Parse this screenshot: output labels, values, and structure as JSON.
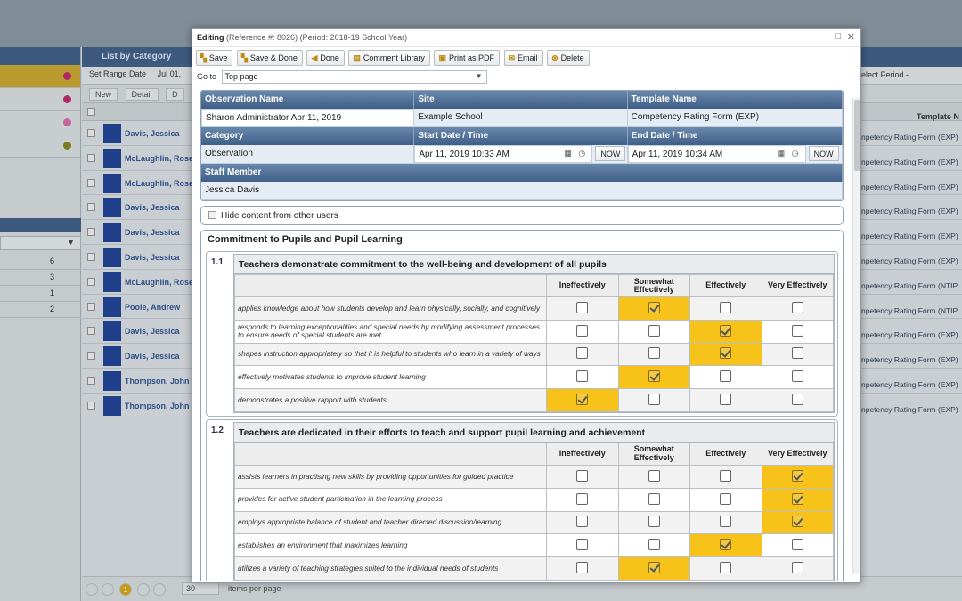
{
  "background": {
    "list_header": "List by Category",
    "toolbar": {
      "set_range": "Set Range Date",
      "date_fragment": "Jul 01,"
    },
    "actions": {
      "new": "New",
      "detail": "Detail",
      "more": "D"
    },
    "period_select": "elect Period -",
    "grid_header_right": "Template N",
    "left_dots": [
      "#b0286a",
      "#b0286a",
      "#c4669c",
      "#7a7a20"
    ],
    "counts": [
      "6",
      "3",
      "1",
      "2"
    ],
    "rows": [
      {
        "name": "Davis, Jessica",
        "template": "npetency Rating Form (EXP)"
      },
      {
        "name": "McLaughlin, Rose",
        "template": "npetency Rating Form (EXP)"
      },
      {
        "name": "McLaughlin, Rose",
        "template": "npetency Rating Form (EXP)"
      },
      {
        "name": "Davis, Jessica",
        "template": "npetency Rating Form (EXP)"
      },
      {
        "name": "Davis, Jessica",
        "template": "npetency Rating Form (EXP)"
      },
      {
        "name": "Davis, Jessica",
        "template": "npetency Rating Form (EXP)"
      },
      {
        "name": "McLaughlin, Rose",
        "template": "npetency Rating Form (NTIP"
      },
      {
        "name": "Poole, Andrew",
        "template": "npetency Rating Form (NTIP"
      },
      {
        "name": "Davis, Jessica",
        "template": "npetency Rating Form (EXP)"
      },
      {
        "name": "Davis, Jessica",
        "template": "npetency Rating Form (EXP)"
      },
      {
        "name": "Thompson, John",
        "template": "npetency Rating Form (EXP)"
      },
      {
        "name": "Thompson, John",
        "template": "npetency Rating Form (EXP)"
      }
    ],
    "pager": {
      "current_page": "1",
      "page_size": "30",
      "items_per_page": "items per page"
    }
  },
  "dialog": {
    "title_bold": "Editing",
    "title_rest": "(Reference #: 8026) (Period: 2018-19 School Year)",
    "toolbar": {
      "save": "Save",
      "save_done": "Save & Done",
      "done": "Done",
      "comment_library": "Comment Library",
      "print_pdf": "Print as PDF",
      "email": "Email",
      "delete": "Delete"
    },
    "goto_label": "Go to",
    "goto_value": "Top page",
    "info": {
      "observation_name_label": "Observation Name",
      "observation_name": "Sharon Administrator Apr 11, 2019",
      "site_label": "Site",
      "site": "Example School",
      "template_label": "Template Name",
      "template": "Competency Rating Form (EXP)",
      "category_label": "Category",
      "category": "Observation",
      "start_label": "Start Date / Time",
      "start": "Apr 11, 2019 10:33 AM",
      "end_label": "End Date / Time",
      "end": "Apr 11, 2019 10:34 AM",
      "now": "NOW",
      "staff_label": "Staff Member",
      "staff": "Jessica Davis"
    },
    "hide_content": "Hide content from other users",
    "section_title": "Commitment to Pupils and Pupil Learning",
    "rating_columns": [
      "Ineffectively",
      "Somewhat Effectively",
      "Effectively",
      "Very Effectively"
    ],
    "items": [
      {
        "num": "1.1",
        "title": "Teachers demonstrate commitment to the well-being and development of all pupils",
        "rows": [
          {
            "text": "applies knowledge about how students develop and learn physically, socially, and cognitively",
            "selected": 1
          },
          {
            "text": "responds to learning exceptionalities and special needs by modifying assessment processes to ensure needs of special students are met",
            "selected": 2
          },
          {
            "text": "shapes instruction appropriately so that it is helpful to students who learn in a variety of ways",
            "selected": 2
          },
          {
            "text": "effectively motivates students to improve student learning",
            "selected": 1
          },
          {
            "text": "demonstrates a positive rapport with students",
            "selected": 0
          }
        ]
      },
      {
        "num": "1.2",
        "title": "Teachers are dedicated in their efforts to teach and support pupil learning and achievement",
        "rows": [
          {
            "text": "assists learners in practising new skills by providing opportunities for guided practice",
            "selected": 3
          },
          {
            "text": "provides for active student participation in the learning process",
            "selected": 3
          },
          {
            "text": "employs appropriate balance of student and teacher directed discussion/learning",
            "selected": 3
          },
          {
            "text": "establishes an environment that maximizes learning",
            "selected": 2
          },
          {
            "text": "utilizes a variety of teaching strategies suited to the individual needs of students",
            "selected": 1
          }
        ]
      }
    ]
  }
}
